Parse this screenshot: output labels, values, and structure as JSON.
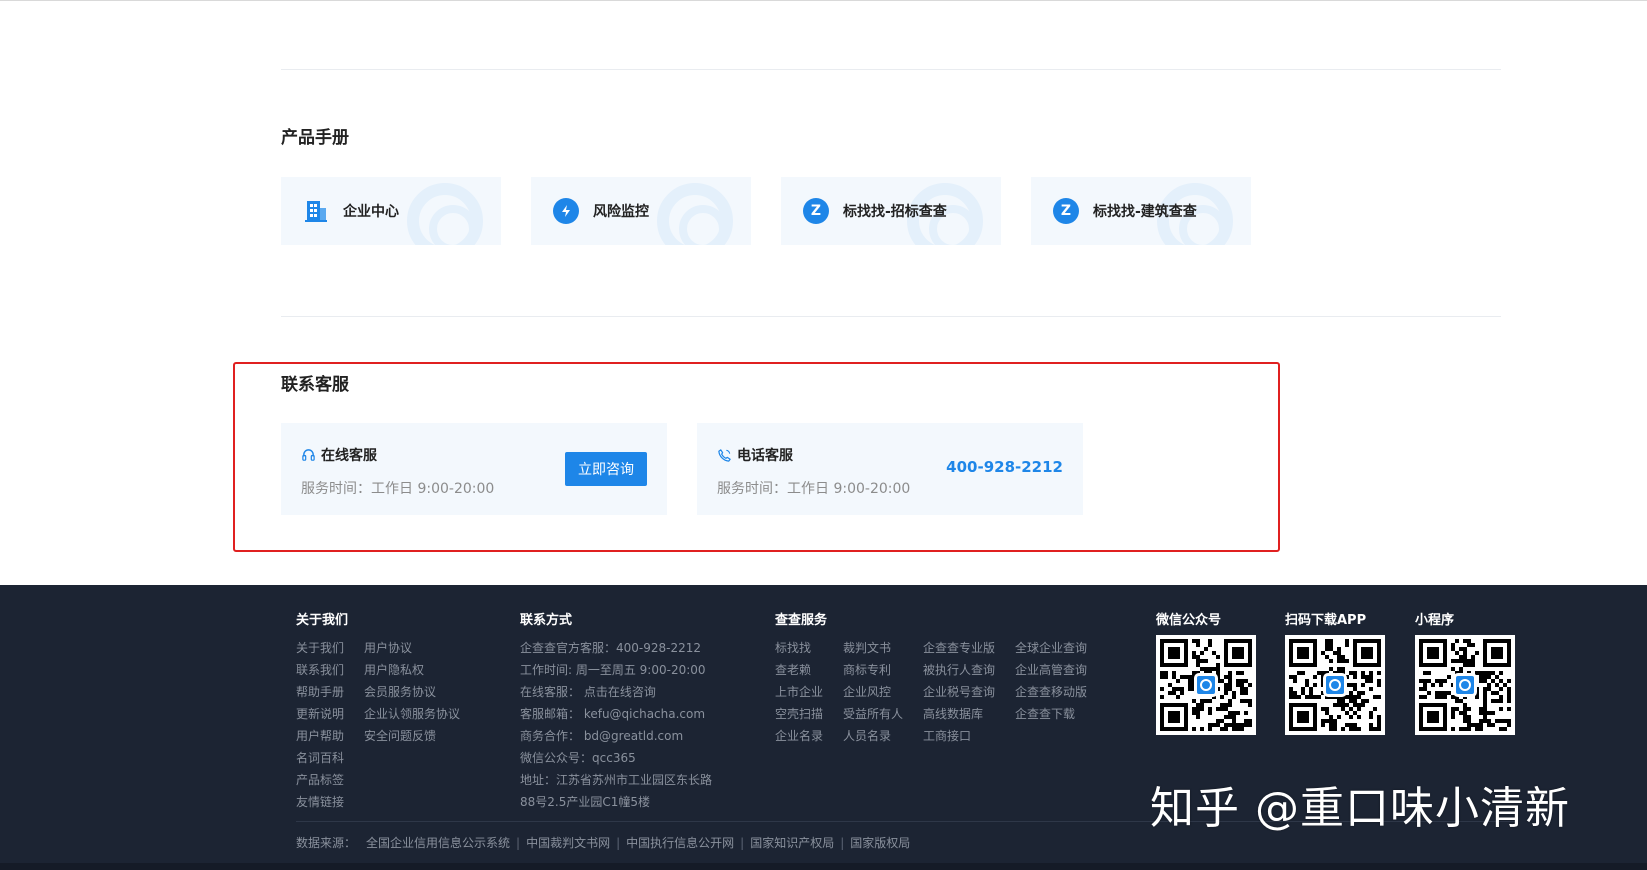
{
  "product_manual": {
    "title": "产品手册",
    "items": [
      {
        "label": "企业中心",
        "icon": "building-icon"
      },
      {
        "label": "风险监控",
        "icon": "shield-icon"
      },
      {
        "label": "标找找-招标查查",
        "icon": "z-logo-icon"
      },
      {
        "label": "标找找-建筑查查",
        "icon": "z-logo-icon"
      }
    ]
  },
  "contact": {
    "title": "联系客服",
    "online": {
      "title": "在线客服",
      "time": "服务时间：工作日 9:00-20:00",
      "button": "立即咨询"
    },
    "phone": {
      "title": "电话客服",
      "time": "服务时间：工作日 9:00-20:00",
      "number": "400-928-2212"
    }
  },
  "footer": {
    "about": {
      "title": "关于我们",
      "col1": [
        "关于我们",
        "联系我们",
        "帮助手册",
        "更新说明",
        "用户帮助",
        "名词百科",
        "产品标签",
        "友情链接"
      ],
      "col2": [
        "用户协议",
        "用户隐私权",
        "会员服务协议",
        "企业认领服务协议",
        "安全问题反馈"
      ]
    },
    "contact": {
      "title": "联系方式",
      "lines": [
        "企查查官方客服：400-928-2212",
        "工作时间: 周一至周五 9:00-20:00",
        "在线客服：  点击在线咨询",
        "客服邮箱：  kefu@qichacha.com",
        "商务合作：  bd@greatld.com",
        "微信公众号：qcc365",
        "地址：江苏省苏州市工业园区东长路",
        "88号2.5产业园C1幢5楼"
      ]
    },
    "services": {
      "title": "查查服务",
      "col1": [
        "标找找",
        "查老赖",
        "上市企业",
        "空壳扫描",
        "企业名录"
      ],
      "col2": [
        "裁判文书",
        "商标专利",
        "企业风控",
        "受益所有人",
        "人员名录"
      ],
      "col3": [
        "企查查专业版",
        "被执行人查询",
        "企业税号查询",
        "高线数据库",
        "工商接口"
      ],
      "col4": [
        "全球企业查询",
        "企业高管查询",
        "企查查移动版",
        "企查查下载"
      ]
    },
    "qr": [
      {
        "title": "微信公众号"
      },
      {
        "title": "扫码下载APP"
      },
      {
        "title": "小程序"
      }
    ],
    "sources_label": "数据来源：",
    "sources": [
      "全国企业信用信息公示系统",
      "中国裁判文书网",
      "中国执行信息公开网",
      "国家知识产权局",
      "国家版权局"
    ]
  },
  "watermark": "知乎 @重口味小清新",
  "colors": {
    "accent": "#1e86e8",
    "highlight_box": "#e02020",
    "footer_bg": "#1c2433"
  }
}
